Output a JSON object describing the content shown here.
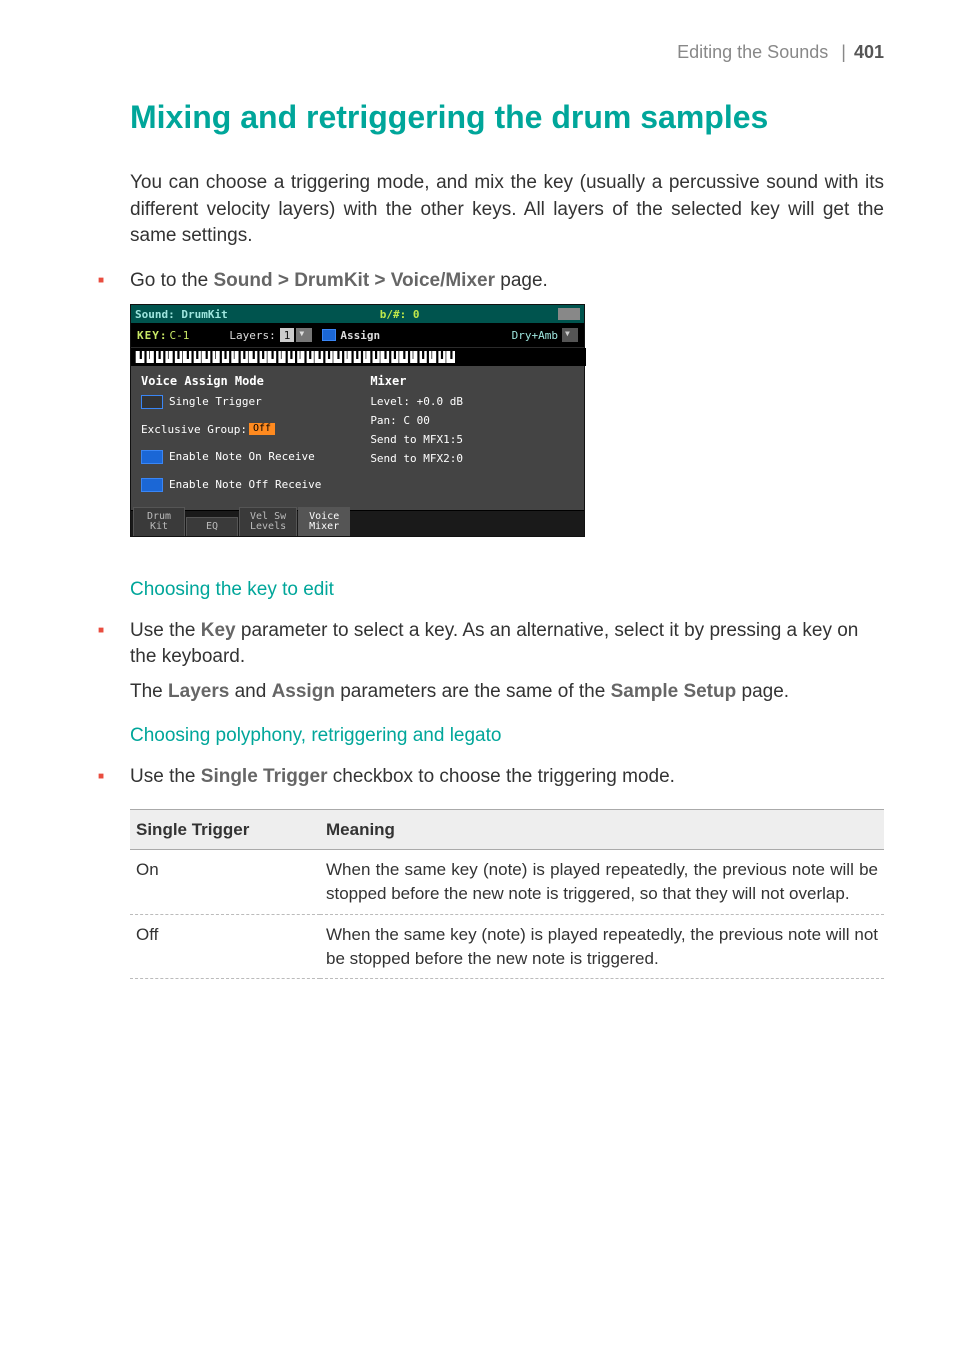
{
  "header": {
    "section": "Editing the Sounds",
    "page": "401"
  },
  "title": "Mixing and retriggering the drum samples",
  "intro": "You can choose a triggering mode, and mix the key (usually a percussive sound with its different velocity layers) with the other keys. All layers of the selected key will get the same settings.",
  "nav_bullet": {
    "pre": "Go to the ",
    "path": "Sound > DrumKit > Voice/Mixer",
    "post": " page."
  },
  "screenshot": {
    "title": "Sound: DrumKit",
    "title_mid": "b/#: 0",
    "key_label": "KEY:",
    "key_value": "C-1",
    "layers_label": "Layers:",
    "layers_value": "1",
    "assign_label": "Assign",
    "right_select": "Dry+Amb",
    "left_heading": "Voice Assign Mode",
    "single_trigger": "Single Trigger",
    "excl_group_lbl": "Exclusive Group:",
    "excl_group_val": "Off",
    "enable_on": "Enable Note On Receive",
    "enable_off": "Enable Note Off Receive",
    "mixer_heading": "Mixer",
    "level_line": "Level:  +0.0  dB",
    "pan_line": "Pan:    C 00",
    "mfx1_line": "Send to MFX1:5",
    "mfx2_line": "Send to MFX2:0",
    "tabs": [
      "Drum\nKit",
      "EQ",
      "Vel Sw\nLevels",
      "Voice\nMixer"
    ]
  },
  "sub1": "Choosing the key to edit",
  "bullet1": {
    "pre": "Use the ",
    "k": "Key",
    "post": " parameter to select a key. As an alternative, select it by pressing a key on the keyboard."
  },
  "para1": {
    "pre": "The ",
    "a": "Layers",
    "mid": " and ",
    "b": "Assign",
    "mid2": " parameters are the same of the ",
    "c": "Sample Setup",
    "post": " page."
  },
  "sub2": "Choosing polyphony, retriggering and legato",
  "bullet2": {
    "pre": "Use the ",
    "k": "Single Trigger",
    "post": " checkbox to choose the triggering mode."
  },
  "table": {
    "headers": [
      "Single Trigger",
      "Meaning"
    ],
    "rows": [
      {
        "c1": "On",
        "c2": "When the same key (note) is played repeatedly, the previous note will be stopped before the new note is triggered, so that they will not overlap."
      },
      {
        "c1": "Off",
        "c2": "When the same key (note) is played repeatedly, the previous note will not be stopped before the new note is triggered."
      }
    ]
  }
}
